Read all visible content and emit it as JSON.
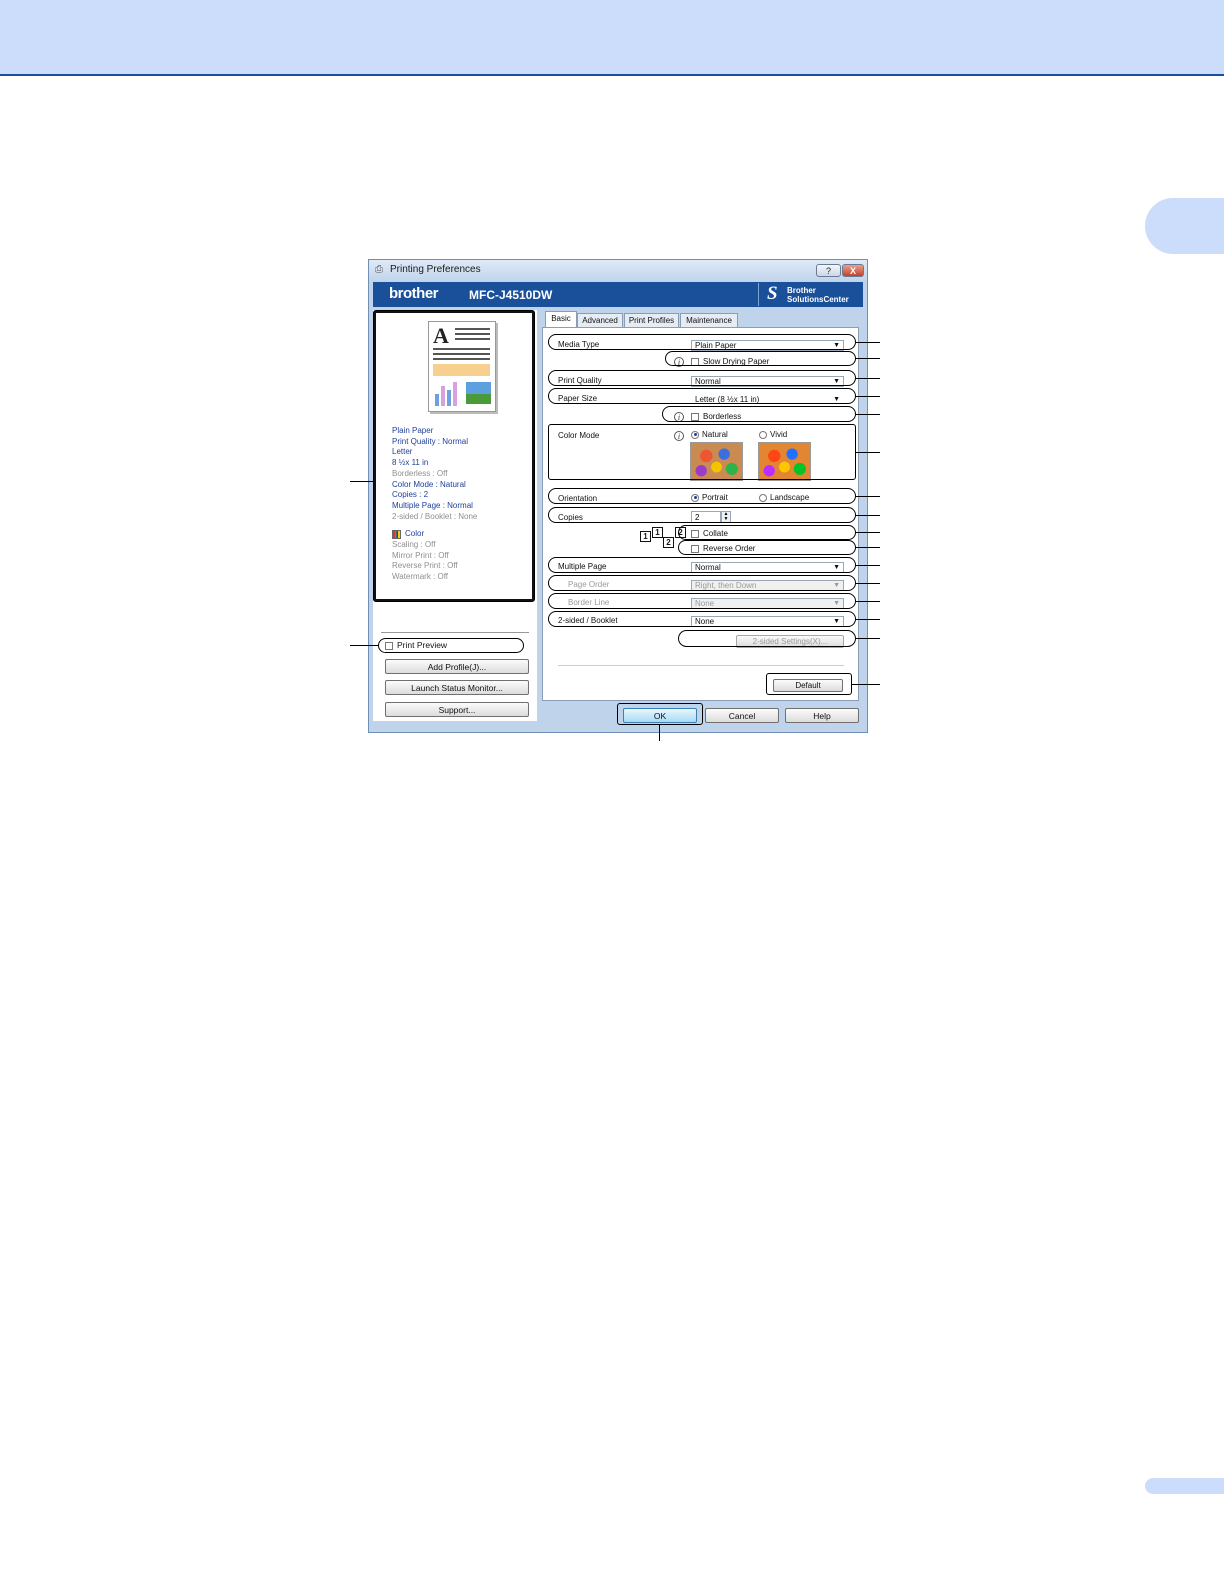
{
  "window": {
    "title": "Printing Preferences",
    "help_glyph": "?",
    "close_glyph": "X"
  },
  "banner": {
    "brand": "brother",
    "model": "MFC-J4510DW",
    "solutions_line1": "Brother",
    "solutions_line2": "SolutionsCenter"
  },
  "preview": {
    "summary_blue": [
      "Plain Paper",
      "Print Quality : Normal",
      "Letter",
      "8 ½x 11 in"
    ],
    "summary_gray1": [
      "Borderless : Off"
    ],
    "summary_blue2": [
      "Color Mode : Natural",
      "Copies : 2",
      "Multiple Page : Normal"
    ],
    "summary_gray2": [
      "2-sided / Booklet : None"
    ],
    "color_label": "Color",
    "summary_gray3": [
      "Scaling : Off",
      "Mirror Print : Off",
      "Reverse Print : Off",
      "Watermark : Off"
    ]
  },
  "left_controls": {
    "print_preview": "Print Preview",
    "add_profile": "Add Profile(J)...",
    "launch_status_monitor": "Launch Status Monitor...",
    "support": "Support..."
  },
  "tabs": [
    "Basic",
    "Advanced",
    "Print Profiles",
    "Maintenance"
  ],
  "basic": {
    "media_type_label": "Media Type",
    "media_type_value": "Plain Paper",
    "slow_drying": "Slow Drying Paper",
    "print_quality_label": "Print Quality",
    "print_quality_value": "Normal",
    "paper_size_label": "Paper Size",
    "paper_size_value": "Letter (8 ½x 11 in)",
    "borderless": "Borderless",
    "color_mode_label": "Color Mode",
    "natural": "Natural",
    "vivid": "Vivid",
    "orientation_label": "Orientation",
    "portrait": "Portrait",
    "landscape": "Landscape",
    "copies_label": "Copies",
    "copies_value": "2",
    "collate": "Collate",
    "reverse_order": "Reverse Order",
    "multiple_page_label": "Multiple Page",
    "multiple_page_value": "Normal",
    "page_order_label": "Page Order",
    "page_order_value": "Right, then Down",
    "border_line_label": "Border Line",
    "border_line_value": "None",
    "two_sided_label": "2-sided / Booklet",
    "two_sided_value": "None",
    "two_sided_settings": "2-sided Settings(X)...",
    "default": "Default"
  },
  "footer": {
    "ok": "OK",
    "cancel": "Cancel",
    "help": "Help"
  },
  "icons": {
    "info": "i",
    "dropdown_arrow": "▼",
    "spin_up": "▲",
    "spin_down": "▼"
  }
}
